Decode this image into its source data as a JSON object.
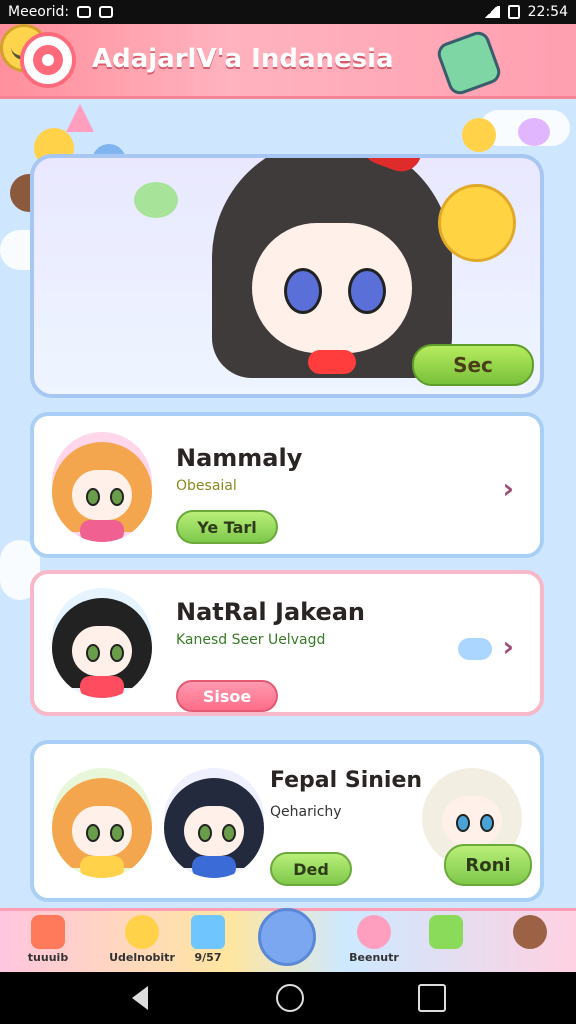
{
  "status_bar": {
    "left_text": "Meeorid:",
    "time": "22:54"
  },
  "header": {
    "title": "AdajarlV'a Indanesia"
  },
  "hero": {
    "button_label": "Sec"
  },
  "cards": [
    {
      "name": "Nammaly",
      "sub": "Obesaial",
      "chip": "Ye Tarl"
    },
    {
      "name": "NatRal Jakean",
      "sub": "Kanesd Seer Uelvagd",
      "chip": "Sisoe"
    },
    {
      "name": "Fepal Sinien",
      "sub": "Qeharichy",
      "chip": "Ded",
      "button": "Roni"
    }
  ],
  "bottom_nav": {
    "items": [
      "tuuuib",
      "Udelnobitr",
      "9/57",
      "Beenutr"
    ]
  },
  "colors": {
    "header_pink": "#ff8f9c",
    "accent_green": "#7ec84a",
    "accent_red": "#ff6e8a"
  }
}
